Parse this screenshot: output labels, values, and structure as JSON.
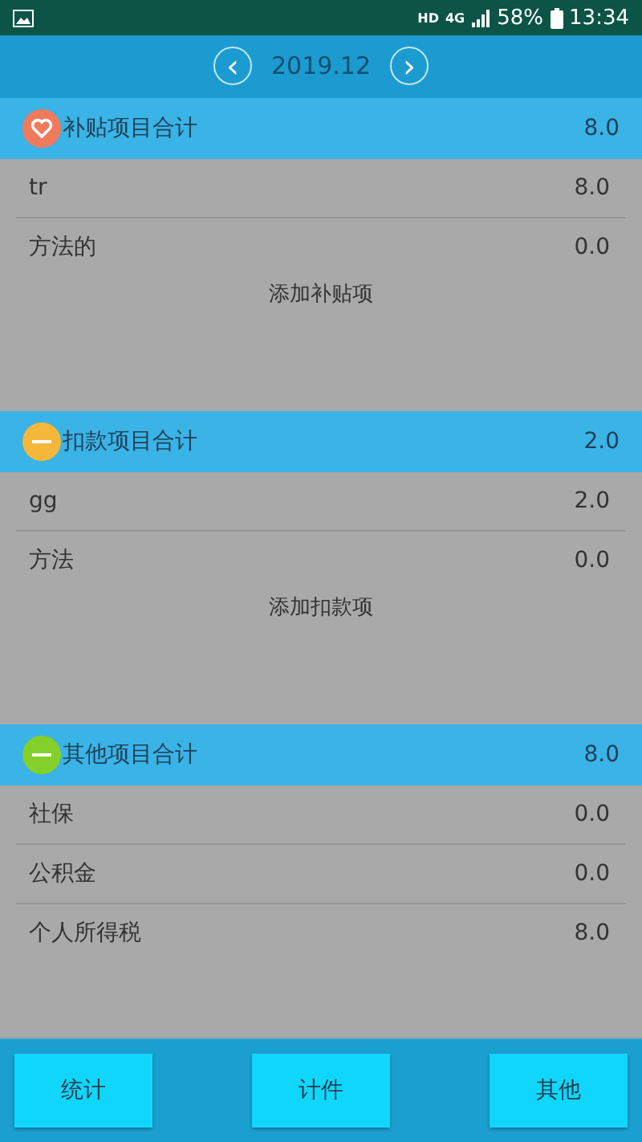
{
  "status_bar": {
    "network": "HD",
    "signal_type": "4G",
    "battery": "58%",
    "time": "13:34"
  },
  "month_nav": {
    "prev": "‹",
    "month": "2019.12",
    "next": "›"
  },
  "sections": [
    {
      "kind": "heart",
      "color": "#f07a5c",
      "title": "补贴项目合计",
      "total": "8.0",
      "rows": [
        {
          "label": "tr",
          "value": "8.0"
        },
        {
          "label": "方法的",
          "value": "0.0"
        }
      ],
      "add_label": "添加补贴项"
    },
    {
      "kind": "minus",
      "color": "#f5b73a",
      "title": "扣款项目合计",
      "total": "2.0",
      "rows": [
        {
          "label": "gg",
          "value": "2.0"
        },
        {
          "label": "方法",
          "value": "0.0"
        }
      ],
      "add_label": "添加扣款项"
    },
    {
      "kind": "minus",
      "color": "#84d02a",
      "title": "其他项目合计",
      "total": "8.0",
      "rows": [
        {
          "label": "社保",
          "value": "0.0"
        },
        {
          "label": "公积金",
          "value": "0.0"
        },
        {
          "label": "个人所得税",
          "value": "8.0"
        }
      ]
    }
  ],
  "bottom_buttons": [
    "统计",
    "计件",
    "其他"
  ]
}
